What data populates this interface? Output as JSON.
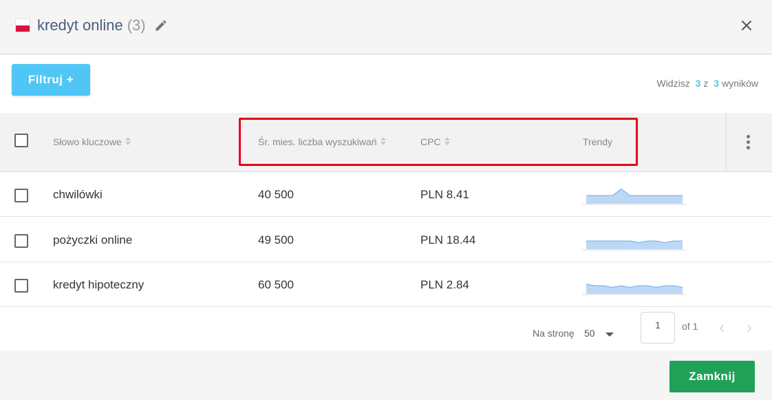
{
  "header": {
    "title": "kredyt online",
    "count": "(3)",
    "flag_icon": "poland-flag-icon",
    "edit_icon": "pencil-icon",
    "close_icon": "close-icon"
  },
  "toolbar": {
    "filter_label": "Filtruj +",
    "results_prefix": "Widzisz",
    "results_shown": "3",
    "results_mid": "z",
    "results_total": "3",
    "results_suffix": "wyników"
  },
  "table": {
    "columns": [
      "Słowo kluczowe",
      "Śr. mies. liczba wyszukiwań",
      "CPC",
      "Trendy"
    ],
    "rows": [
      {
        "keyword": "chwilówki",
        "searches": "40 500",
        "cpc": "PLN 8.41",
        "trend": [
          1,
          1,
          1,
          1,
          1.8,
          1,
          1,
          1,
          1,
          1,
          1,
          1
        ]
      },
      {
        "keyword": "pożyczki online",
        "searches": "49 500",
        "cpc": "PLN 18.44",
        "trend": [
          1,
          1,
          1,
          1,
          1,
          1,
          0.8,
          1,
          1,
          0.8,
          1,
          1
        ]
      },
      {
        "keyword": "kredyt hipoteczny",
        "searches": "60 500",
        "cpc": "PLN 2.84",
        "trend": [
          1.2,
          1,
          1,
          0.8,
          1,
          0.8,
          1,
          1,
          0.8,
          1,
          1,
          0.8
        ]
      }
    ]
  },
  "pagination": {
    "per_page_label": "Na stronę",
    "per_page_value": "50",
    "page": "1",
    "of_label": "of 1"
  },
  "footer": {
    "close_label": "Zamknij"
  },
  "colors": {
    "accent": "#4fc6f5",
    "primary_button": "#20a157",
    "highlight": "#e3001b",
    "trend_fill": "#bcd8f5",
    "trend_line": "#6fa9e6"
  }
}
